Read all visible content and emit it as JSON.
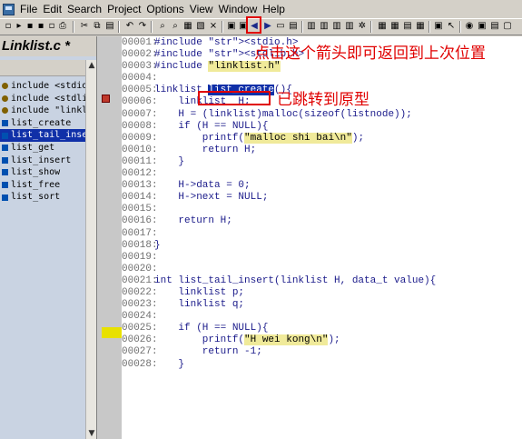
{
  "menu": [
    "File",
    "Edit",
    "Search",
    "Project",
    "Options",
    "View",
    "Window",
    "Help"
  ],
  "file_tab": "Linklist.c *",
  "symbols": [
    {
      "label": "include <stdio.h>",
      "kind": "inc"
    },
    {
      "label": "include <stdlib.h>",
      "kind": "inc"
    },
    {
      "label": "include \"linklist.",
      "kind": "inc"
    },
    {
      "label": "list_create",
      "kind": "fn"
    },
    {
      "label": "list_tail_insert",
      "kind": "fn",
      "selected": true
    },
    {
      "label": "list_get",
      "kind": "fn"
    },
    {
      "label": "list_insert",
      "kind": "fn"
    },
    {
      "label": "list_show",
      "kind": "fn"
    },
    {
      "label": "list_free",
      "kind": "fn"
    },
    {
      "label": "list_sort",
      "kind": "fn"
    }
  ],
  "code": [
    {
      "n": "00001:",
      "t": "#include <stdio.h>"
    },
    {
      "n": "00002:",
      "t": "#include <stdlib.h>"
    },
    {
      "n": "00003:",
      "t": "#include \"linklist.h\""
    },
    {
      "n": "00004:",
      "t": ""
    },
    {
      "n": "00005:",
      "t": "linklist list_create(){"
    },
    {
      "n": "00006:",
      "t": "    linklist  H;"
    },
    {
      "n": "00007:",
      "t": "    H = (linklist)malloc(sizeof(listnode));"
    },
    {
      "n": "00008:",
      "t": "    if (H == NULL){"
    },
    {
      "n": "00009:",
      "t": "        printf(\"malloc shi bai\\n\");"
    },
    {
      "n": "00010:",
      "t": "        return H;"
    },
    {
      "n": "00011:",
      "t": "    }"
    },
    {
      "n": "00012:",
      "t": ""
    },
    {
      "n": "00013:",
      "t": "    H->data = 0;"
    },
    {
      "n": "00014:",
      "t": "    H->next = NULL;"
    },
    {
      "n": "00015:",
      "t": ""
    },
    {
      "n": "00016:",
      "t": "    return H;"
    },
    {
      "n": "00017:",
      "t": ""
    },
    {
      "n": "00018:",
      "t": "}"
    },
    {
      "n": "00019:",
      "t": ""
    },
    {
      "n": "00020:",
      "t": ""
    },
    {
      "n": "00021:",
      "t": "int list_tail_insert(linklist H, data_t value){"
    },
    {
      "n": "00022:",
      "t": "    linklist p;"
    },
    {
      "n": "00023:",
      "t": "    linklist q;"
    },
    {
      "n": "00024:",
      "t": ""
    },
    {
      "n": "00025:",
      "t": "    if (H == NULL){"
    },
    {
      "n": "00026:",
      "t": "        printf(\"H wei kong\\n\");"
    },
    {
      "n": "00027:",
      "t": "        return -1;"
    },
    {
      "n": "00028:",
      "t": "    }"
    }
  ],
  "annotations": {
    "back_arrow": "点击这个箭头即可返回到上次位置",
    "jumped": "已跳转到原型"
  }
}
